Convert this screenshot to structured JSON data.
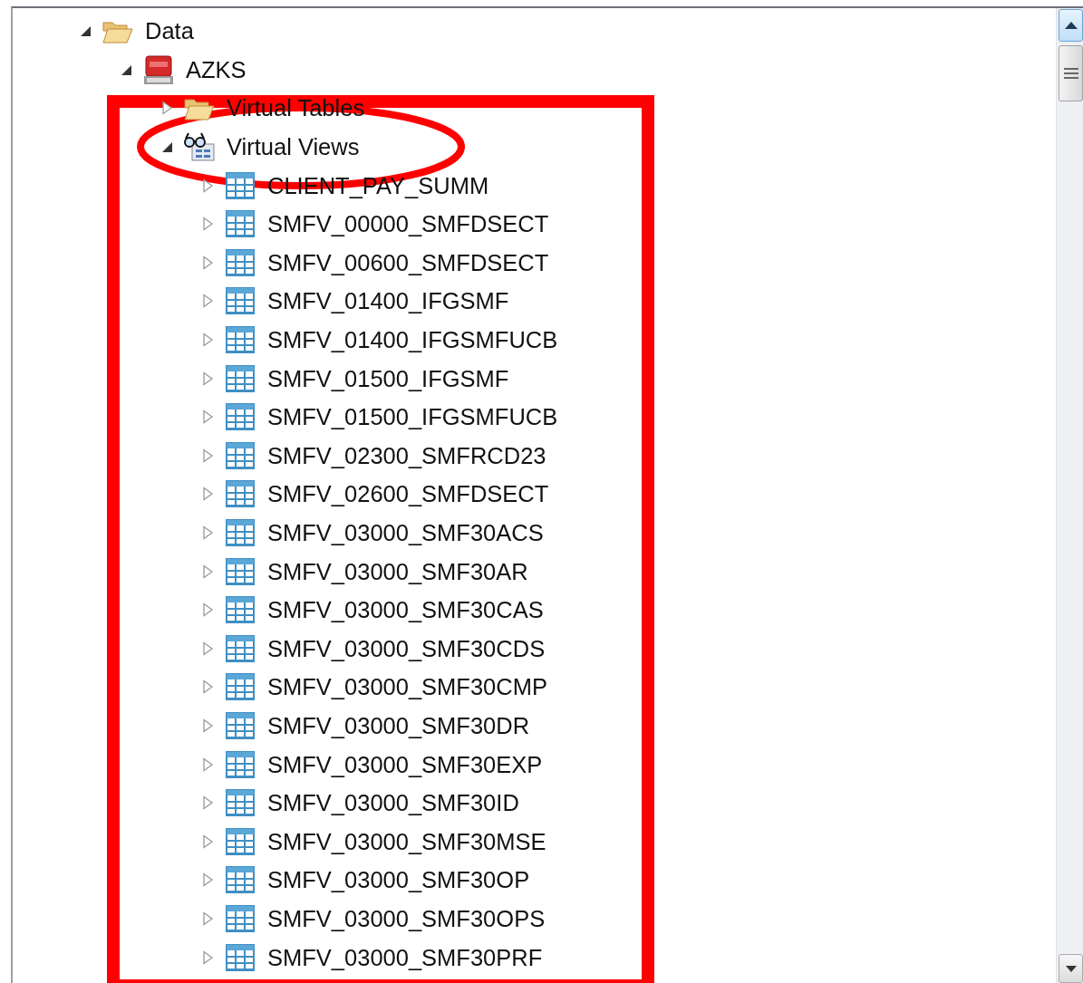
{
  "tree": [
    {
      "label": "Data",
      "kind": "folder",
      "expanded": true,
      "children": [
        {
          "label": "AZKS",
          "kind": "database",
          "expanded": true,
          "children": [
            {
              "label": "Virtual Tables",
              "kind": "folder",
              "expanded": false
            },
            {
              "label": "Virtual Views",
              "kind": "views",
              "expanded": true,
              "children": [
                {
                  "label": "CLIENT_PAY_SUMM",
                  "kind": "table",
                  "expanded": false
                },
                {
                  "label": "SMFV_00000_SMFDSECT",
                  "kind": "table",
                  "expanded": false
                },
                {
                  "label": "SMFV_00600_SMFDSECT",
                  "kind": "table",
                  "expanded": false
                },
                {
                  "label": "SMFV_01400_IFGSMF",
                  "kind": "table",
                  "expanded": false
                },
                {
                  "label": "SMFV_01400_IFGSMFUCB",
                  "kind": "table",
                  "expanded": false
                },
                {
                  "label": "SMFV_01500_IFGSMF",
                  "kind": "table",
                  "expanded": false
                },
                {
                  "label": "SMFV_01500_IFGSMFUCB",
                  "kind": "table",
                  "expanded": false
                },
                {
                  "label": "SMFV_02300_SMFRCD23",
                  "kind": "table",
                  "expanded": false
                },
                {
                  "label": "SMFV_02600_SMFDSECT",
                  "kind": "table",
                  "expanded": false
                },
                {
                  "label": "SMFV_03000_SMF30ACS",
                  "kind": "table",
                  "expanded": false
                },
                {
                  "label": "SMFV_03000_SMF30AR",
                  "kind": "table",
                  "expanded": false
                },
                {
                  "label": "SMFV_03000_SMF30CAS",
                  "kind": "table",
                  "expanded": false
                },
                {
                  "label": "SMFV_03000_SMF30CDS",
                  "kind": "table",
                  "expanded": false
                },
                {
                  "label": "SMFV_03000_SMF30CMP",
                  "kind": "table",
                  "expanded": false
                },
                {
                  "label": "SMFV_03000_SMF30DR",
                  "kind": "table",
                  "expanded": false
                },
                {
                  "label": "SMFV_03000_SMF30EXP",
                  "kind": "table",
                  "expanded": false
                },
                {
                  "label": "SMFV_03000_SMF30ID",
                  "kind": "table",
                  "expanded": false
                },
                {
                  "label": "SMFV_03000_SMF30MSE",
                  "kind": "table",
                  "expanded": false
                },
                {
                  "label": "SMFV_03000_SMF30OP",
                  "kind": "table",
                  "expanded": false
                },
                {
                  "label": "SMFV_03000_SMF30OPS",
                  "kind": "table",
                  "expanded": false
                },
                {
                  "label": "SMFV_03000_SMF30PRF",
                  "kind": "table",
                  "expanded": false
                }
              ]
            }
          ]
        }
      ]
    }
  ],
  "highlight_box": {
    "color": "#ff0000"
  },
  "highlight_ellipse": {
    "color": "#ff0000"
  }
}
